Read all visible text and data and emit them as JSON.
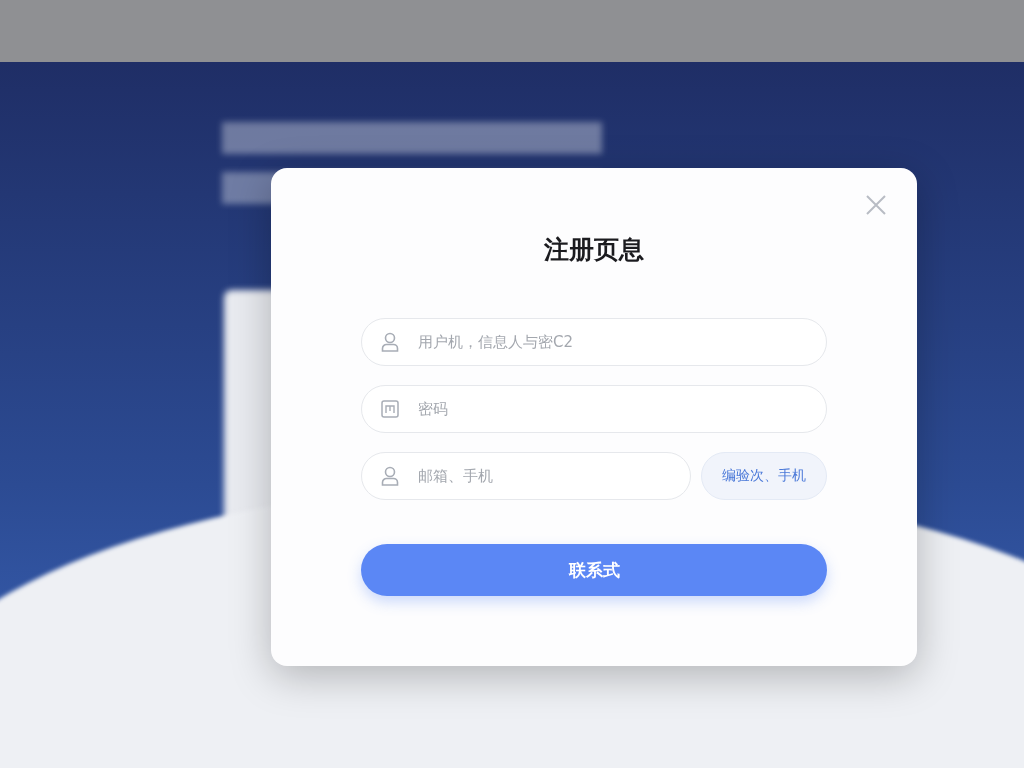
{
  "dialog": {
    "title": "注册页息",
    "fields": [
      {
        "kind": "user",
        "placeholder": "用户机，信息人与密C2"
      },
      {
        "kind": "lock",
        "placeholder": "密码"
      },
      {
        "kind": "user",
        "placeholder": "邮箱、手机",
        "action": "编验次、手机"
      }
    ],
    "submit": "联系式"
  }
}
